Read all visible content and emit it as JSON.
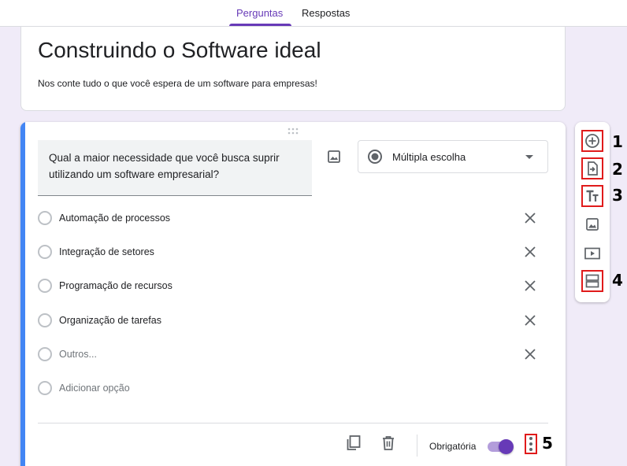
{
  "tabs": [
    {
      "label": "Perguntas",
      "active": true
    },
    {
      "label": "Respostas",
      "active": false
    }
  ],
  "form": {
    "title": "Construindo o Software ideal",
    "description": "Nos conte tudo o que você espera de um software para empresas!"
  },
  "question": {
    "text": "Qual a maior necessidade que você busca suprir utilizando um software empresarial?",
    "type_label": "Múltipla escolha",
    "options": [
      "Automação de processos",
      "Integração de setores",
      "Programação de recursos",
      "Organização de tarefas"
    ],
    "other_label": "Outros...",
    "add_option_label": "Adicionar opção",
    "required_label": "Obrigatória",
    "required_on": true
  },
  "toolbar_icons": [
    "add-question-icon",
    "import-questions-icon",
    "add-title-icon",
    "add-image-icon",
    "add-video-icon",
    "add-section-icon"
  ],
  "markers": [
    "1",
    "2",
    "3",
    "4",
    "5"
  ],
  "colors": {
    "accent": "#673ab7",
    "card_accent": "#4285f4",
    "background": "#f0ebf8",
    "highlight": "#e01b1b"
  }
}
